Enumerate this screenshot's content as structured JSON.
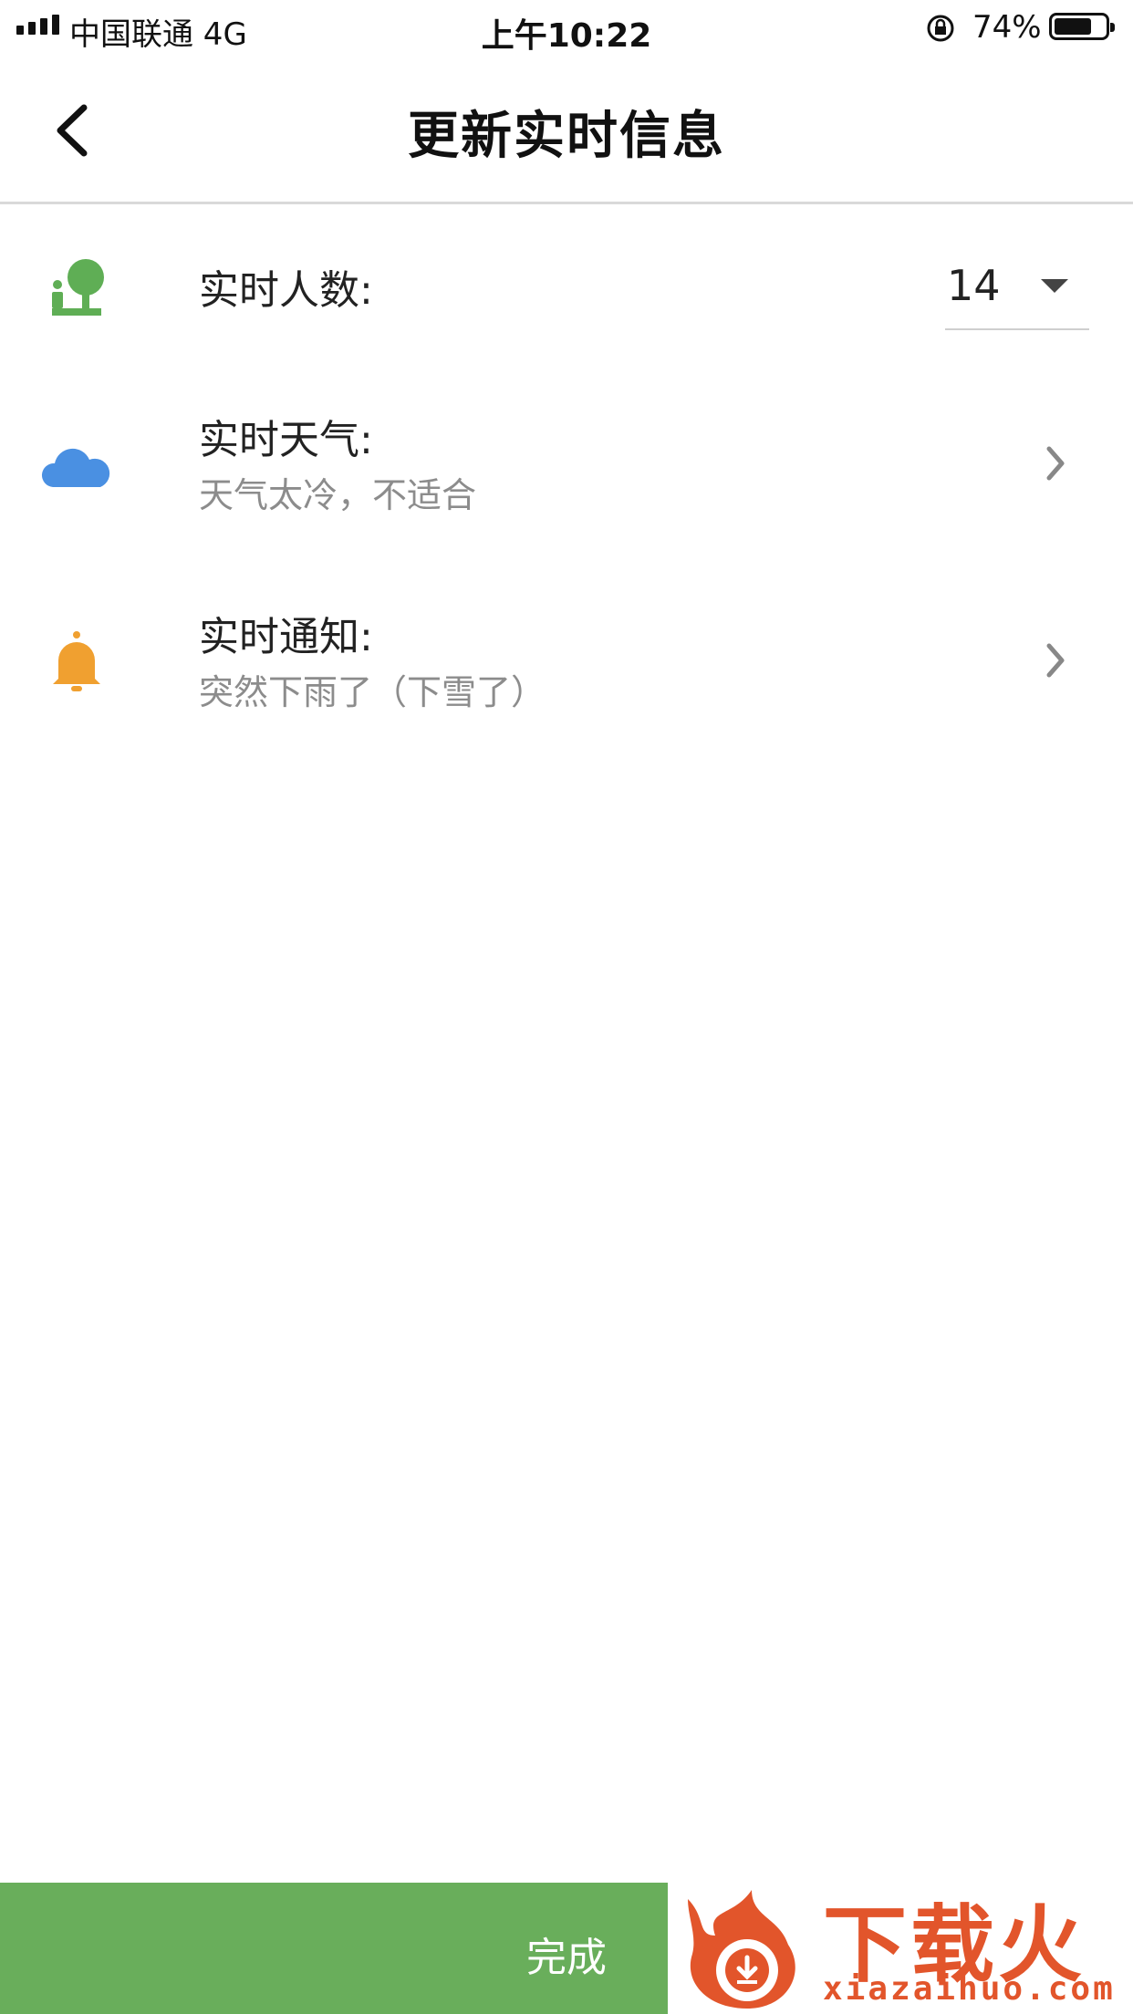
{
  "status_bar": {
    "carrier": "中国联通   4G",
    "time": "上午10:22",
    "battery_percent": "74%",
    "battery_level": 0.74
  },
  "nav": {
    "title": "更新实时信息",
    "back_icon": "chevron-left-icon"
  },
  "rows": {
    "people": {
      "icon": "tree-person-icon",
      "icon_color": "#5fae55",
      "label": "实时人数:",
      "value": "14"
    },
    "weather": {
      "icon": "cloud-icon",
      "icon_color": "#4a90e2",
      "label": "实时天气:",
      "subtitle": "天气太冷，不适合"
    },
    "notice": {
      "icon": "bell-icon",
      "icon_color": "#f0a030",
      "label": "实时通知:",
      "subtitle": "突然下雨了（下雪了）"
    }
  },
  "footer": {
    "done_label": "完成",
    "done_color": "#69ae5b"
  },
  "watermark": {
    "text": "下载火",
    "url": "xiazaihuo.com",
    "color": "#e2552b"
  }
}
